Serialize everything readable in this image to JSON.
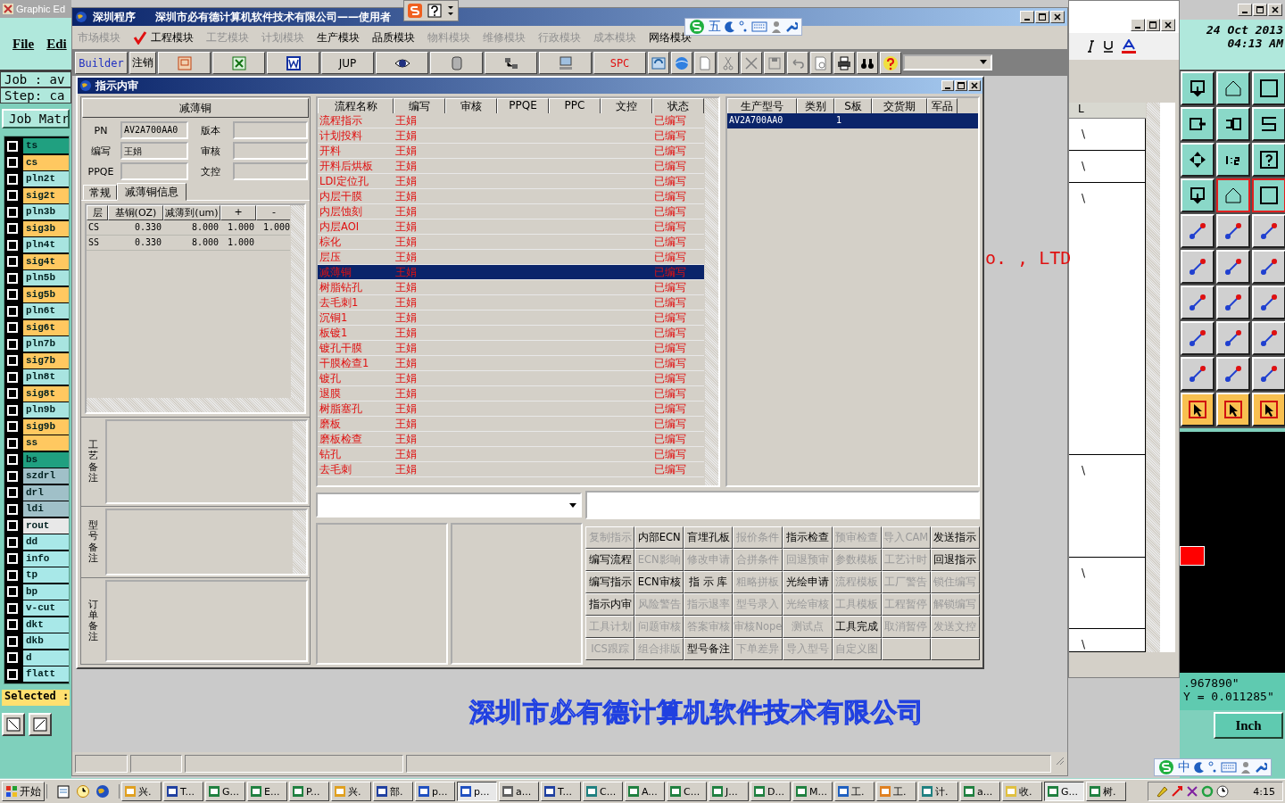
{
  "graphic_editor": {
    "title": "Graphic Ed",
    "menu": [
      "File",
      "Edi"
    ],
    "job": "Job : av",
    "step": "Step: ca",
    "job_matrix_button": "Job Matr",
    "layers": [
      {
        "name": "ts",
        "color": "#20a080"
      },
      {
        "name": "cs",
        "color": "#ffc860"
      },
      {
        "name": "pln2t",
        "color": "#a8e4e0"
      },
      {
        "name": "sig2t",
        "color": "#ffc860"
      },
      {
        "name": "pln3b",
        "color": "#a8e4e0"
      },
      {
        "name": "sig3b",
        "color": "#ffc860"
      },
      {
        "name": "pln4t",
        "color": "#a8e4e0"
      },
      {
        "name": "sig4t",
        "color": "#ffc860"
      },
      {
        "name": "pln5b",
        "color": "#a8e4e0"
      },
      {
        "name": "sig5b",
        "color": "#ffc860"
      },
      {
        "name": "pln6t",
        "color": "#a8e4e0"
      },
      {
        "name": "sig6t",
        "color": "#ffc860"
      },
      {
        "name": "pln7b",
        "color": "#a8e4e0"
      },
      {
        "name": "sig7b",
        "color": "#ffc860"
      },
      {
        "name": "pln8t",
        "color": "#a8e4e0"
      },
      {
        "name": "sig8t",
        "color": "#ffc860"
      },
      {
        "name": "pln9b",
        "color": "#a8e4e0"
      },
      {
        "name": "sig9b",
        "color": "#ffc860"
      },
      {
        "name": "ss",
        "color": "#ffc860"
      },
      {
        "name": "bs",
        "color": "#20a080"
      },
      {
        "name": "szdrl",
        "color": "#a0c0c8"
      },
      {
        "name": "drl",
        "color": "#a0c0c8"
      },
      {
        "name": "ldi",
        "color": "#a0c0c8"
      },
      {
        "name": "rout",
        "color": "#e8e8e8"
      },
      {
        "name": "dd",
        "color": "#a8e8e8"
      },
      {
        "name": "info",
        "color": "#a8e8e8"
      },
      {
        "name": "tp",
        "color": "#a8e8e8"
      },
      {
        "name": "bp",
        "color": "#a8e8e8"
      },
      {
        "name": "v-cut",
        "color": "#a8e8e8"
      },
      {
        "name": "dkt",
        "color": "#a8e8e8"
      },
      {
        "name": "dkb",
        "color": "#a8e8e8"
      },
      {
        "name": "d",
        "color": "#a8e8e8"
      },
      {
        "name": "flatt",
        "color": "#a8e8e8"
      }
    ],
    "selected_label": "Selected :",
    "date": "24 Oct 2013",
    "time": "04:13 AM",
    "x_coord": ".967890\"",
    "y_coord": "Y = 0.011285\"",
    "units_button": "Inch"
  },
  "excel_window": {
    "column": "L",
    "cells": [
      "\\",
      "\\",
      "\\",
      "\\",
      "\\",
      "\\"
    ]
  },
  "floating_ime": {
    "mode": "五"
  },
  "main_window": {
    "title": "深圳程序",
    "company": "深圳市必有德计算机软件技术有限公司——使用者",
    "modules": [
      {
        "label": "市场模块",
        "disabled": true,
        "checked": false
      },
      {
        "label": "工程模块",
        "disabled": false,
        "checked": true
      },
      {
        "label": "工艺模块",
        "disabled": true,
        "checked": false
      },
      {
        "label": "计划模块",
        "disabled": true,
        "checked": false
      },
      {
        "label": "生产模块",
        "disabled": false,
        "checked": false
      },
      {
        "label": "品质模块",
        "disabled": false,
        "checked": false
      },
      {
        "label": "物料模块",
        "disabled": true,
        "checked": false
      },
      {
        "label": "维修模块",
        "disabled": true,
        "checked": false
      },
      {
        "label": "行政模块",
        "disabled": true,
        "checked": false
      },
      {
        "label": "成本模块",
        "disabled": true,
        "checked": false
      },
      {
        "label": "网络模块",
        "disabled": false,
        "checked": false
      }
    ],
    "toolbar": {
      "builder": "Builder",
      "logout": "注销",
      "jup": "JUP",
      "spc": "SPC"
    },
    "logo_text": "深圳市必有德计算机软件技术有限公司",
    "ltd_text": "o. , LTD"
  },
  "dialog": {
    "title": "指示内审",
    "header": "减薄铜",
    "fields": [
      {
        "label": "PN",
        "value": "AV2A700AA0"
      },
      {
        "label": "版本"
      },
      {
        "label": "编写",
        "value": "王娟"
      },
      {
        "label": "审核"
      },
      {
        "label": "PPQE"
      },
      {
        "label": "文控"
      }
    ],
    "tabs": [
      {
        "label": "常规",
        "selected": false
      },
      {
        "label": "减薄铜信息",
        "selected": true
      }
    ],
    "copper_table": {
      "columns": [
        "层",
        "基铜(OZ)",
        "减薄到(um)",
        "+",
        "-"
      ],
      "rows": [
        [
          "CS",
          "0.330",
          "8.000",
          "1.000",
          "1.000"
        ],
        [
          "SS",
          "0.330",
          "8.000",
          "1.000"
        ]
      ]
    },
    "notes": [
      "工艺备注",
      "型号备注",
      "订单备注"
    ],
    "flow_table": {
      "columns": [
        "流程名称",
        "编写",
        "审核",
        "PPQE",
        "PPC",
        "文控",
        "状态"
      ],
      "rows": [
        {
          "name": "流程指示",
          "author": "王娟",
          "status": "已编写",
          "selected": false
        },
        {
          "name": "计划投料",
          "author": "王娟",
          "status": "已编写",
          "selected": false
        },
        {
          "name": "开料",
          "author": "王娟",
          "status": "已编写",
          "selected": false
        },
        {
          "name": "开料后烘板",
          "author": "王娟",
          "status": "已编写",
          "selected": false
        },
        {
          "name": "LDI定位孔",
          "author": "王娟",
          "status": "已编写",
          "selected": false
        },
        {
          "name": "内层干膜",
          "author": "王娟",
          "status": "已编写",
          "selected": false
        },
        {
          "name": "内层蚀刻",
          "author": "王娟",
          "status": "已编写",
          "selected": false
        },
        {
          "name": "内层AOI",
          "author": "王娟",
          "status": "已编写",
          "selected": false
        },
        {
          "name": "棕化",
          "author": "王娟",
          "status": "已编写",
          "selected": false
        },
        {
          "name": "层压",
          "author": "王娟",
          "status": "已编写",
          "selected": false
        },
        {
          "name": "减薄铜",
          "author": "王娟",
          "status": "已编写",
          "selected": true
        },
        {
          "name": "树脂钻孔",
          "author": "王娟",
          "status": "已编写",
          "selected": false
        },
        {
          "name": "去毛刺1",
          "author": "王娟",
          "status": "已编写",
          "selected": false
        },
        {
          "name": "沉铜1",
          "author": "王娟",
          "status": "已编写",
          "selected": false
        },
        {
          "name": "板镀1",
          "author": "王娟",
          "status": "已编写",
          "selected": false
        },
        {
          "name": "镀孔干膜",
          "author": "王娟",
          "status": "已编写",
          "selected": false
        },
        {
          "name": "干膜检查1",
          "author": "王娟",
          "status": "已编写",
          "selected": false
        },
        {
          "name": "镀孔",
          "author": "王娟",
          "status": "已编写",
          "selected": false
        },
        {
          "name": "退膜",
          "author": "王娟",
          "status": "已编写",
          "selected": false
        },
        {
          "name": "树脂塞孔",
          "author": "王娟",
          "status": "已编写",
          "selected": false
        },
        {
          "name": "磨板",
          "author": "王娟",
          "status": "已编写",
          "selected": false
        },
        {
          "name": "磨板检查",
          "author": "王娟",
          "status": "已编写",
          "selected": false
        },
        {
          "name": "钻孔",
          "author": "王娟",
          "status": "已编写",
          "selected": false
        },
        {
          "name": "去毛刺",
          "author": "王娟",
          "status": "已编写",
          "selected": false
        }
      ]
    },
    "order_table": {
      "columns": [
        "生产型号",
        "类别",
        "S板",
        "交货期",
        "军品"
      ],
      "rows": [
        {
          "model": "AV2A700AA0",
          "board": "1",
          "selected": true
        }
      ]
    },
    "buttons": [
      {
        "label": "复制指示",
        "disabled": true
      },
      {
        "label": "内部ECN",
        "disabled": false
      },
      {
        "label": "盲埋孔板",
        "disabled": false
      },
      {
        "label": "报价条件",
        "disabled": true
      },
      {
        "label": "指示检查",
        "disabled": false
      },
      {
        "label": "预审检查",
        "disabled": true
      },
      {
        "label": "导入CAM",
        "disabled": true
      },
      {
        "label": "发送指示",
        "disabled": false
      },
      {
        "label": "编写流程",
        "disabled": false
      },
      {
        "label": "ECN影响",
        "disabled": true
      },
      {
        "label": "修改申请",
        "disabled": true
      },
      {
        "label": "合拼条件",
        "disabled": true
      },
      {
        "label": "回退预审",
        "disabled": true
      },
      {
        "label": "参数模板",
        "disabled": true
      },
      {
        "label": "工艺计时",
        "disabled": true
      },
      {
        "label": "回退指示",
        "disabled": false
      },
      {
        "label": "编写指示",
        "disabled": false
      },
      {
        "label": "ECN审核",
        "disabled": false
      },
      {
        "label": "指 示 库",
        "disabled": false
      },
      {
        "label": "粗略拼板",
        "disabled": true
      },
      {
        "label": "光绘申请",
        "disabled": false
      },
      {
        "label": "流程模板",
        "disabled": true
      },
      {
        "label": "工厂警告",
        "disabled": true
      },
      {
        "label": "锁住编写",
        "disabled": true
      },
      {
        "label": "指示内审",
        "disabled": false
      },
      {
        "label": "风险警告",
        "disabled": true
      },
      {
        "label": "指示退率",
        "disabled": true
      },
      {
        "label": "型号录入",
        "disabled": true
      },
      {
        "label": "光绘审核",
        "disabled": true
      },
      {
        "label": "工具模板",
        "disabled": true
      },
      {
        "label": "工程暂停",
        "disabled": true
      },
      {
        "label": "解锁编写",
        "disabled": true
      },
      {
        "label": "工具计划",
        "disabled": true
      },
      {
        "label": "问题审核",
        "disabled": true
      },
      {
        "label": "答案审核",
        "disabled": true
      },
      {
        "label": "审核Nope",
        "disabled": true
      },
      {
        "label": "测试点",
        "disabled": true
      },
      {
        "label": "工具完成",
        "disabled": false
      },
      {
        "label": "取消暂停",
        "disabled": true
      },
      {
        "label": "发送文控",
        "disabled": true
      },
      {
        "label": "ICS跟踪",
        "disabled": true
      },
      {
        "label": "组合排版",
        "disabled": true
      },
      {
        "label": "型号备注",
        "disabled": false
      },
      {
        "label": "下单差异",
        "disabled": true
      },
      {
        "label": "导入型号",
        "disabled": true
      },
      {
        "label": "自定义图",
        "disabled": true
      }
    ]
  },
  "taskbar": {
    "start": "开始",
    "tasks": [
      {
        "label": "兴.",
        "selected": false
      },
      {
        "label": "T...",
        "selected": false
      },
      {
        "label": "G...",
        "selected": false
      },
      {
        "label": "E...",
        "selected": false
      },
      {
        "label": "P...",
        "selected": false
      },
      {
        "label": "兴.",
        "selected": false
      },
      {
        "label": "部.",
        "selected": false
      },
      {
        "label": "p...",
        "selected": false
      },
      {
        "label": "p...",
        "selected": true
      },
      {
        "label": "a...",
        "selected": false
      },
      {
        "label": "T...",
        "selected": false
      },
      {
        "label": "C...",
        "selected": false
      },
      {
        "label": "A...",
        "selected": false
      },
      {
        "label": "C...",
        "selected": false
      },
      {
        "label": "J...",
        "selected": false
      },
      {
        "label": "D...",
        "selected": false
      },
      {
        "label": "M...",
        "selected": false
      },
      {
        "label": "工.",
        "selected": false
      },
      {
        "label": "工.",
        "selected": false
      },
      {
        "label": "计.",
        "selected": false
      },
      {
        "label": "a...",
        "selected": false
      },
      {
        "label": "收.",
        "selected": false
      },
      {
        "label": "G...",
        "selected": true
      },
      {
        "label": "树.",
        "selected": false
      }
    ],
    "ime": "中",
    "clock": "4:15"
  }
}
